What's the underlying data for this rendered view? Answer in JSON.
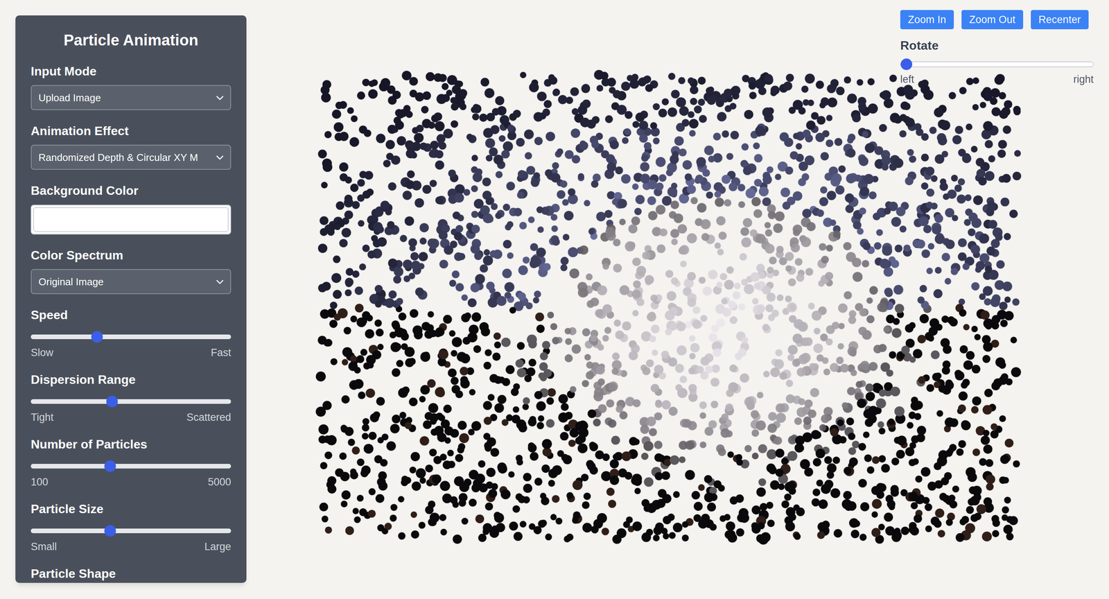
{
  "panel": {
    "title": "Particle Animation",
    "fields": [
      {
        "kind": "select",
        "label": "Input Mode",
        "value": "Upload Image"
      },
      {
        "kind": "select",
        "label": "Animation Effect",
        "value": "Randomized Depth & Circular XY M"
      },
      {
        "kind": "color",
        "label": "Background Color",
        "color": "#ffffff"
      },
      {
        "kind": "select",
        "label": "Color Spectrum",
        "value": "Original Image"
      },
      {
        "kind": "slider",
        "label": "Speed",
        "level": 0.32,
        "min_label": "Slow",
        "max_label": "Fast"
      },
      {
        "kind": "slider",
        "label": "Dispersion Range",
        "level": 0.4,
        "min_label": "Tight",
        "max_label": "Scattered"
      },
      {
        "kind": "slider",
        "label": "Number of Particles",
        "level": 0.39,
        "min_label": "100",
        "max_label": "5000"
      },
      {
        "kind": "slider",
        "label": "Particle Size",
        "level": 0.39,
        "min_label": "Small",
        "max_label": "Large"
      },
      {
        "kind": "heading",
        "label": "Particle Shape"
      }
    ]
  },
  "view_controls": {
    "buttons": [
      "Zoom In",
      "Zoom Out",
      "Recenter"
    ],
    "rotate": {
      "label": "Rotate",
      "level": 0,
      "min_label": "left",
      "max_label": "right"
    }
  }
}
